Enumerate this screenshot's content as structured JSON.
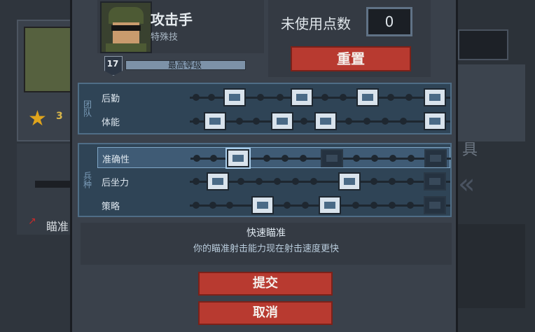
{
  "background": {
    "left_badge_count": "3",
    "left_red_text": "瞄准",
    "right_text": "具"
  },
  "header": {
    "class_name": "攻击手",
    "class_type": "特殊技",
    "level": "17",
    "level_bar_label": "最高等级",
    "level_fill": 1.0
  },
  "points": {
    "label": "未使用点数",
    "value": "0",
    "reset_label": "重置"
  },
  "groups": [
    {
      "label": "团队",
      "rows": [
        {
          "name": "后勤",
          "selected": false
        },
        {
          "name": "体能",
          "selected": false
        }
      ]
    },
    {
      "label": "兵种",
      "rows": [
        {
          "name": "准确性",
          "selected": true
        },
        {
          "name": "后坐力",
          "selected": false
        },
        {
          "name": "策略",
          "selected": false
        }
      ]
    }
  ],
  "description": {
    "title": "快速瞄准",
    "body": "你的瞄准射击能力现在射击速度更快"
  },
  "buttons": {
    "submit": "提交",
    "cancel": "取消"
  },
  "colors": {
    "accent_red": "#b83a30",
    "panel": "#3a414b",
    "group_bg": "#2f4456"
  }
}
